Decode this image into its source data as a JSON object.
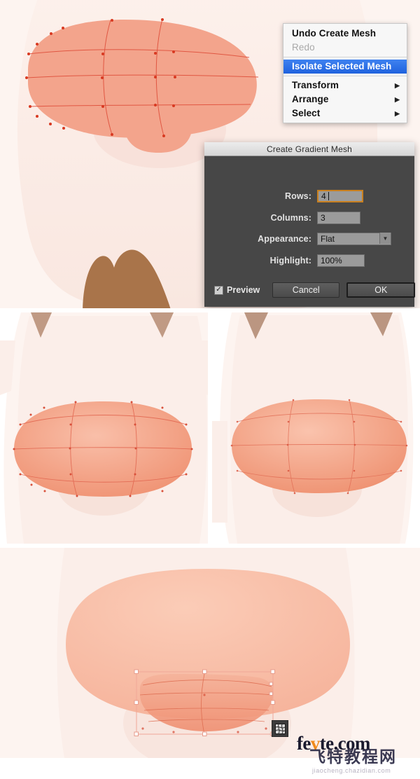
{
  "app": {
    "context_menu": {
      "items": [
        {
          "label": "Undo Create Mesh",
          "state": "normal",
          "submenu": false
        },
        {
          "label": "Redo",
          "state": "disabled",
          "submenu": false
        },
        {
          "label": "Isolate Selected Mesh",
          "state": "selected",
          "submenu": false
        },
        {
          "label": "Transform",
          "state": "normal",
          "submenu": true
        },
        {
          "label": "Arrange",
          "state": "normal",
          "submenu": true
        },
        {
          "label": "Select",
          "state": "normal",
          "submenu": true
        }
      ],
      "submenu_arrow": "▶",
      "highlight_color": "#2a6fe8"
    },
    "dialog": {
      "title": "Create Gradient Mesh",
      "fields": {
        "rows_label": "Rows:",
        "rows_value": "4",
        "columns_label": "Columns:",
        "columns_value": "3",
        "appearance_label": "Appearance:",
        "appearance_value": "Flat",
        "appearance_arrow": "▼",
        "highlight_label": "Highlight:",
        "highlight_value": "100%"
      },
      "preview_label": "Preview",
      "preview_checked": true,
      "preview_check_glyph": "✓",
      "cancel_label": "Cancel",
      "ok_label": "OK",
      "background_color": "#474747",
      "focus_color": "#c9801f"
    },
    "watermark": {
      "brand_pre": "fe",
      "brand_accent": "v",
      "brand_post": "te.com",
      "brand_cn": "飞特教程网",
      "sub": "jiaocheng.chazidian.com"
    },
    "canvas": {
      "base_fill": "#f3a48c",
      "mesh_line_color": "#e0533f",
      "anchor_color": "#d83a22",
      "background": "#fdf4f0",
      "body_fill": "#faeae4",
      "ear_fill": "#b5apply",
      "selection_color": "#f0a898",
      "tool_badge_name": "gradient-mesh-tool-icon"
    },
    "steps": [
      {
        "id": "step-1",
        "caption": "mesh created with visible mesh grid, context menu and dialog open"
      },
      {
        "id": "step-2",
        "caption": "mesh shape left variant"
      },
      {
        "id": "step-3",
        "caption": "mesh shape right variant"
      },
      {
        "id": "step-4",
        "caption": "finished smooth gradient shape with selected sub-mesh"
      }
    ]
  }
}
